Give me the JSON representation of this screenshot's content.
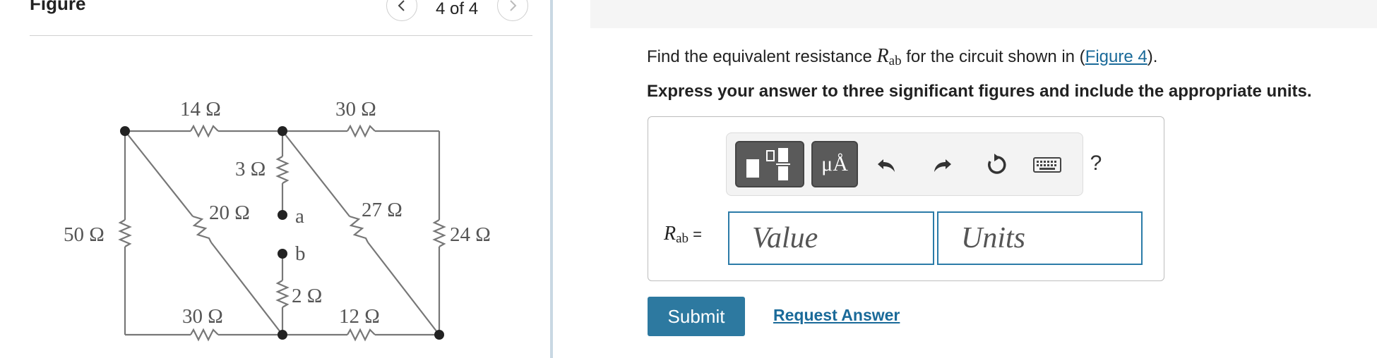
{
  "figure_panel": {
    "title": "Figure",
    "page_counter": "4 of 4",
    "circuit": {
      "resistors": {
        "r14": "14 Ω",
        "r30_top": "30 Ω",
        "r3": "3 Ω",
        "r20": "20 Ω",
        "r27": "27 Ω",
        "r50": "50 Ω",
        "r24": "24 Ω",
        "r2": "2 Ω",
        "r30_bottom": "30 Ω",
        "r12": "12 Ω"
      },
      "terminals": {
        "a": "a",
        "b": "b"
      }
    }
  },
  "question": {
    "prefix": "Find the equivalent resistance ",
    "var": "R",
    "sub": "ab",
    "mid": " for the circuit shown in (",
    "link": "Figure 4",
    "suffix": ").",
    "instruction": "Express your answer to three significant figures and include the appropriate units."
  },
  "answer": {
    "label_var": "R",
    "label_sub": "ab",
    "label_eq": " =",
    "value_placeholder": "Value",
    "units_placeholder": "Units",
    "units_button": "μÅ",
    "help": "?"
  },
  "actions": {
    "submit": "Submit",
    "request": "Request Answer"
  }
}
